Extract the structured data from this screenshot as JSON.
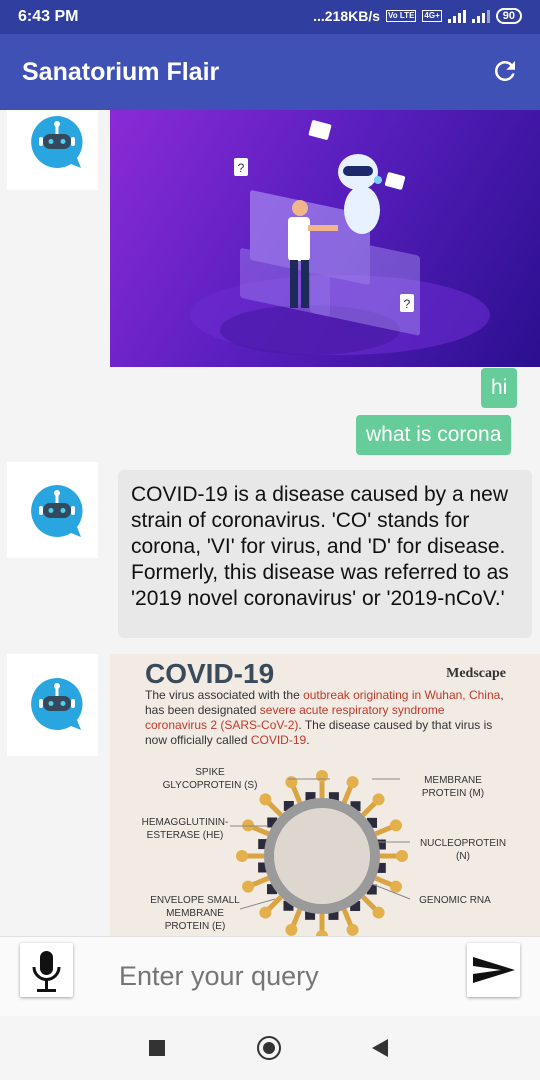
{
  "status_bar": {
    "time": "6:43 PM",
    "speed": "...218KB/s",
    "battery": "90",
    "network_tag": "4G+",
    "volte_tag": "Vo LTE"
  },
  "app_bar": {
    "title": "Sanatorium Flair",
    "refresh_icon": "refresh-icon"
  },
  "messages": {
    "user_1": "hi",
    "user_2": "what is corona",
    "bot_text": "COVID-19 is a disease caused by a new strain of coronavirus. 'CO' stands for corona, 'VI' for virus, and 'D' for disease. Formerly, this disease was referred to as '2019 novel coronavirus' or '2019-nCoV.'"
  },
  "infographic": {
    "heading": "COVID-19",
    "source": "Medscape",
    "intro_1": "The virus associated with the ",
    "intro_r1": "outbreak originating in Wuhan, China",
    "intro_2": ", has been designated ",
    "intro_r2": "severe acute respiratory syndrome coronavirus 2 (SARS-CoV-2)",
    "intro_3": ". The disease caused by that virus is now officially called ",
    "intro_r3": "COVID-19",
    "intro_4": ".",
    "labels": {
      "spike": "SPIKE GLYCOPROTEIN (S)",
      "membrane": "MEMBRANE PROTEIN (M)",
      "he": "HEMAGGLUTININ-ESTERASE (HE)",
      "nucleo": "NUCLEOPROTEIN (N)",
      "envelope": "ENVELOPE SMALL MEMBRANE PROTEIN (E)",
      "rna": "GENOMIC RNA"
    }
  },
  "input": {
    "placeholder": "Enter your query",
    "mic_icon": "microphone-icon",
    "send_icon": "send-icon"
  },
  "colors": {
    "status_bar": "#303f9f",
    "app_bar": "#3f51b5",
    "user_bubble": "#66cc99",
    "bot_bubble": "#e8e8e8",
    "bot_icon": "#29a6e0"
  }
}
